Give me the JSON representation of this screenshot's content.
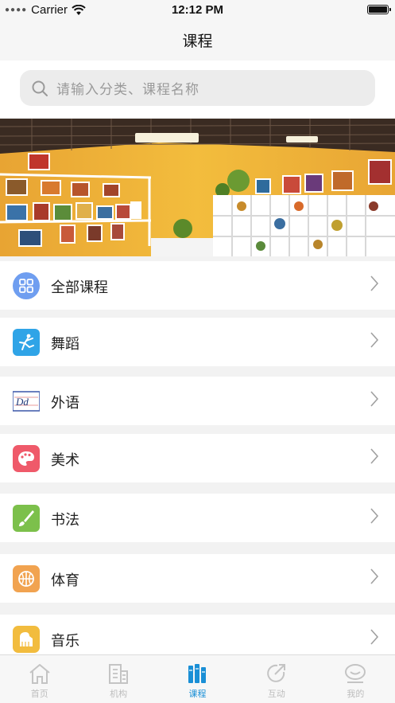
{
  "status_bar": {
    "carrier": "Carrier",
    "time": "12:12 PM"
  },
  "nav": {
    "title": "课程"
  },
  "search": {
    "placeholder": "请输入分类、课程名称"
  },
  "categories": [
    {
      "label": "全部课程",
      "icon": "grid-icon",
      "color": "#6f9ef0"
    },
    {
      "label": "舞蹈",
      "icon": "dancer-icon",
      "color": "#2fa4e7"
    },
    {
      "label": "外语",
      "icon": "letters-dd-icon",
      "color": "#3a56a8"
    },
    {
      "label": "美术",
      "icon": "palette-icon",
      "color": "#ef5a6a"
    },
    {
      "label": "书法",
      "icon": "brush-icon",
      "color": "#7cc04b"
    },
    {
      "label": "体育",
      "icon": "basketball-icon",
      "color": "#f1a350"
    },
    {
      "label": "音乐",
      "icon": "piano-icon",
      "color": "#f2bc3e"
    }
  ],
  "tabs": [
    {
      "label": "首页",
      "icon": "home-icon",
      "active": false
    },
    {
      "label": "机构",
      "icon": "building-icon",
      "active": false
    },
    {
      "label": "课程",
      "icon": "books-icon",
      "active": true
    },
    {
      "label": "互动",
      "icon": "share-icon",
      "active": false
    },
    {
      "label": "我的",
      "icon": "profile-icon",
      "active": false
    }
  ],
  "colors": {
    "accent": "#1a8fd6",
    "inactive_tab": "#bdbdbd",
    "page_bg": "#f2f2f2"
  }
}
